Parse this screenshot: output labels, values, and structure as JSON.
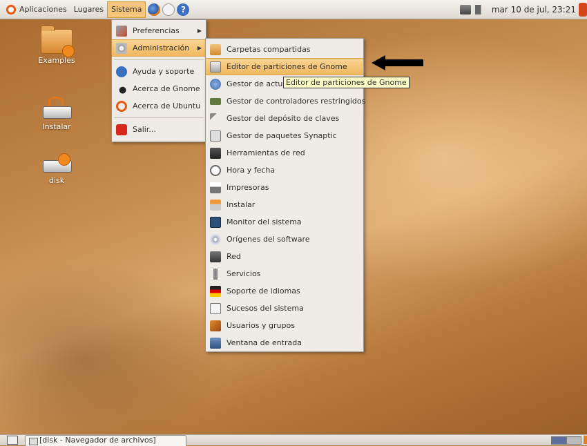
{
  "top_panel": {
    "menus": [
      "Aplicaciones",
      "Lugares",
      "Sistema"
    ],
    "clock": "mar 10 de jul, 23:21",
    "launchers": [
      "firefox-icon",
      "mail-icon",
      "help-icon"
    ],
    "help_glyph": "?"
  },
  "desktop_icons": [
    {
      "label": "Examples",
      "icon": "folder-icon"
    },
    {
      "label": "Instalar",
      "icon": "install-drive-icon"
    },
    {
      "label": "disk",
      "icon": "drive-icon"
    }
  ],
  "sistema_menu": {
    "items": [
      {
        "label": "Preferencias",
        "icon": "preferences-icon",
        "submenu": true
      },
      {
        "label": "Administración",
        "icon": "administration-icon",
        "submenu": true,
        "highlighted": true
      },
      {
        "label": "Ayuda y soporte",
        "icon": "help-icon"
      },
      {
        "label": "Acerca de Gnome",
        "icon": "gnome-icon"
      },
      {
        "label": "Acerca de Ubuntu",
        "icon": "ubuntu-icon"
      },
      {
        "label": "Salir...",
        "icon": "power-icon"
      }
    ]
  },
  "admin_menu": {
    "items": [
      {
        "label": "Carpetas compartidas",
        "icon": "shared-folder-icon"
      },
      {
        "label": "Editor de particiones de Gnome",
        "icon": "partition-editor-icon",
        "highlighted": true
      },
      {
        "label": "Gestor de actua",
        "icon": "update-manager-icon"
      },
      {
        "label": "Gestor de controladores restringidos",
        "icon": "driver-icon"
      },
      {
        "label": "Gestor del depósito de claves",
        "icon": "keyring-icon"
      },
      {
        "label": "Gestor de paquetes Synaptic",
        "icon": "synaptic-icon"
      },
      {
        "label": "Herramientas de red",
        "icon": "network-tools-icon"
      },
      {
        "label": "Hora y fecha",
        "icon": "clock-icon"
      },
      {
        "label": "Impresoras",
        "icon": "printer-icon"
      },
      {
        "label": "Instalar",
        "icon": "install-icon"
      },
      {
        "label": "Monitor del sistema",
        "icon": "system-monitor-icon"
      },
      {
        "label": "Orígenes del software",
        "icon": "software-sources-icon"
      },
      {
        "label": "Red",
        "icon": "network-icon"
      },
      {
        "label": "Servicios",
        "icon": "services-icon"
      },
      {
        "label": "Soporte de idiomas",
        "icon": "language-icon"
      },
      {
        "label": "Sucesos del sistema",
        "icon": "log-icon"
      },
      {
        "label": "Usuarios y grupos",
        "icon": "users-icon"
      },
      {
        "label": "Ventana de entrada",
        "icon": "login-window-icon"
      }
    ]
  },
  "tooltip": "Editor de particiones de Gnome",
  "taskbar": {
    "window_button": "[disk - Navegador de archivos]"
  },
  "colors": {
    "highlight": "#f0b85f",
    "tooltip_bg": "#fefdc7",
    "menu_bg": "#efebe6"
  }
}
